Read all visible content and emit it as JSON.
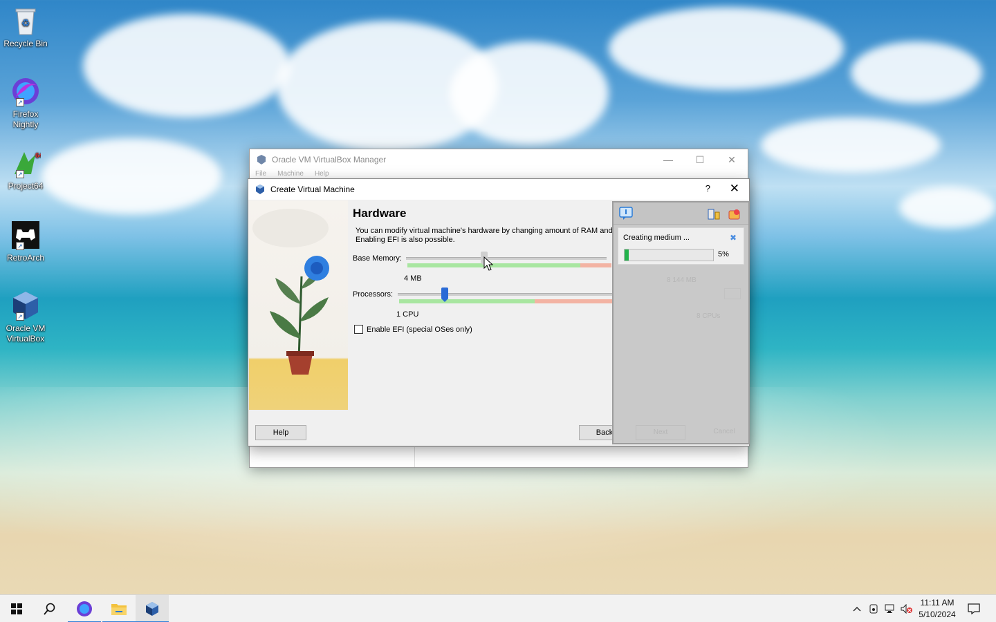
{
  "desktop": {
    "icons": [
      {
        "label": "Recycle Bin"
      },
      {
        "label": "Firefox Nightly"
      },
      {
        "label": "Project64"
      },
      {
        "label": "RetroArch"
      },
      {
        "label": "Oracle VM VirtualBox"
      }
    ]
  },
  "manager": {
    "title": "Oracle VM VirtualBox Manager",
    "menu": [
      "File",
      "Machine",
      "Help"
    ]
  },
  "dialog": {
    "title": "Create Virtual Machine",
    "help_glyph": "?",
    "heading": "Hardware",
    "description_line1": "You can modify virtual machine's hardware by changing amount of RAM and v",
    "description_line2": "Enabling EFI is also possible.",
    "base_memory_label": "Base Memory:",
    "memory_min": "4 MB",
    "memory_max": "8 144 MB",
    "processors_label": "Processors:",
    "cpu_min": "1 CPU",
    "cpu_max": "8 CPUs",
    "efi_label": "Enable EFI (special OSes only)",
    "efi_checked": false,
    "buttons": {
      "help": "Help",
      "back": "Back",
      "next": "Next",
      "cancel": "Cancel"
    }
  },
  "progress_panel": {
    "task": "Creating medium ...",
    "percent_text": "5%",
    "percent_value": 0.05
  },
  "taskbar": {
    "time": "11:11 AM",
    "date": "5/10/2024"
  },
  "colors": {
    "progress_fill": "#22b34b",
    "slider_green": "#a8e6a0",
    "slider_red": "#f3b3a3",
    "handle_blue": "#2a6bd6"
  }
}
